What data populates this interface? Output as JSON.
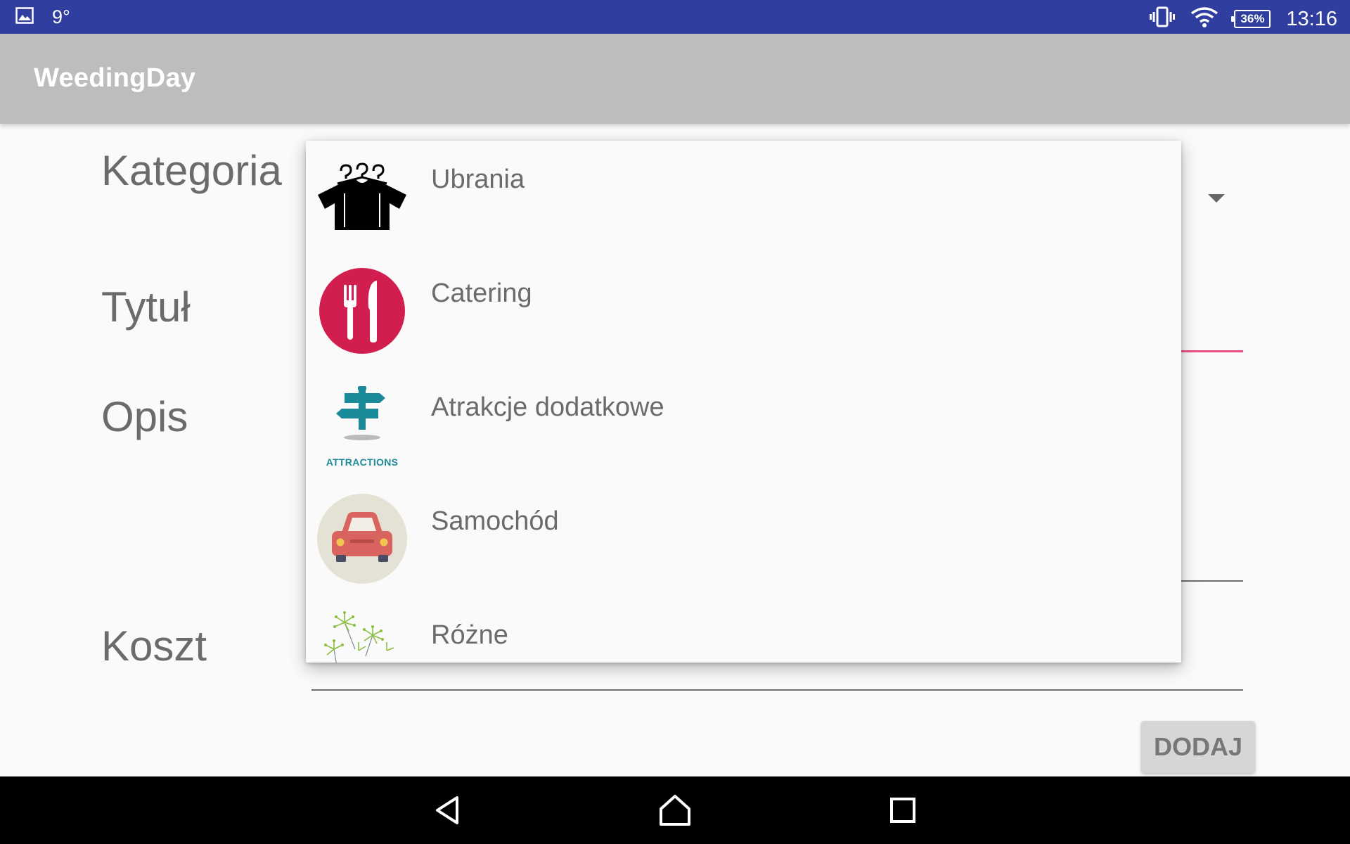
{
  "status_bar": {
    "temperature": "9°",
    "battery": "36%",
    "time": "13:16",
    "icons": [
      "gallery-notification-icon",
      "vibrate-icon",
      "wifi-icon",
      "battery-icon"
    ],
    "background_color": "#303f9f"
  },
  "app_bar": {
    "title": "WeedingDay",
    "background_color": "#bdbdbd"
  },
  "form": {
    "category_label": "Kategoria",
    "title_label": "Tytuł",
    "description_label": "Opis",
    "cost_label": "Koszt",
    "title_value": "",
    "description_value": "",
    "cost_value": "",
    "submit_button": "DODAJ",
    "accent_color": "#ec4f86"
  },
  "dropdown": {
    "items": [
      {
        "label": "Ubrania",
        "icon": "clothes-hangers-icon"
      },
      {
        "label": "Catering",
        "icon": "fork-knife-icon"
      },
      {
        "label": "Atrakcje dodatkowe",
        "icon": "signpost-attractions-icon",
        "icon_caption": "ATTRACTIONS"
      },
      {
        "label": "Samochód",
        "icon": "car-icon"
      },
      {
        "label": "Różne",
        "icon": "dandelion-icon"
      }
    ]
  },
  "nav_bar": {
    "buttons": [
      "back",
      "home",
      "recents"
    ]
  }
}
